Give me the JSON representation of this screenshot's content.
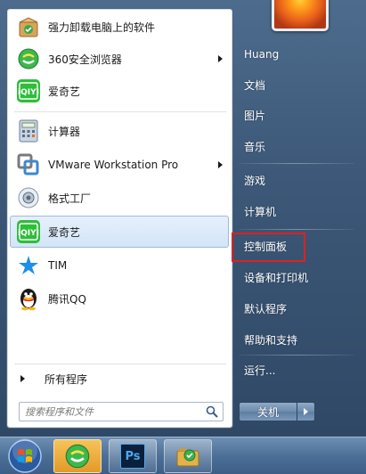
{
  "programs": [
    {
      "label": "强力卸载电脑上的软件",
      "icon": "uninstall-icon",
      "submenu": false
    },
    {
      "label": "360安全浏览器",
      "icon": "360-browser-icon",
      "submenu": true
    },
    {
      "label": "爱奇艺",
      "icon": "iqiyi-icon",
      "submenu": false
    },
    {
      "label": "计算器",
      "icon": "calculator-icon",
      "submenu": false
    },
    {
      "label": "VMware Workstation Pro",
      "icon": "vmware-icon",
      "submenu": true
    },
    {
      "label": "格式工厂",
      "icon": "format-factory-icon",
      "submenu": false
    },
    {
      "label": "爱奇艺",
      "icon": "iqiyi-icon",
      "submenu": false
    },
    {
      "label": "TIM",
      "icon": "tim-icon",
      "submenu": false
    },
    {
      "label": "腾讯QQ",
      "icon": "qq-icon",
      "submenu": false
    }
  ],
  "all_programs_label": "所有程序",
  "search": {
    "placeholder": "搜索程序和文件"
  },
  "right_panel": {
    "items": [
      "Huang",
      "文档",
      "图片",
      "音乐",
      "游戏",
      "计算机",
      "控制面板",
      "设备和打印机",
      "默认程序",
      "帮助和支持",
      "运行..."
    ]
  },
  "shutdown": {
    "label": "关机"
  },
  "taskbar": {
    "items": [
      "start-orb-icon",
      "360-browser-icon",
      "photoshop-icon",
      "folder-app-icon"
    ],
    "ps_label": "Ps"
  },
  "colors": {
    "highlight_border": "#e02020",
    "menu_frame": "#3d5878",
    "taskbar": "#4c6f97"
  }
}
